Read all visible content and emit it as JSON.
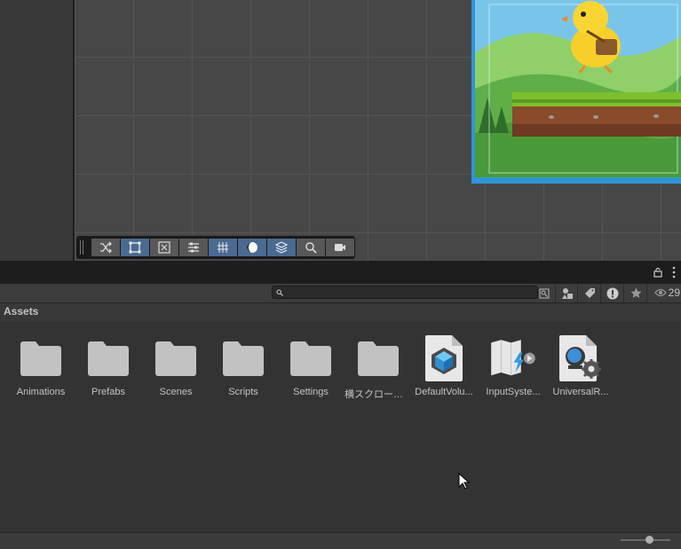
{
  "scene": {
    "toolbar": [
      {
        "name": "shuffle",
        "active": false
      },
      {
        "name": "rect",
        "active": true
      },
      {
        "name": "transform",
        "active": false
      },
      {
        "name": "align",
        "active": false
      },
      {
        "name": "grid",
        "active": true
      },
      {
        "name": "shading",
        "active": true
      },
      {
        "name": "layers",
        "active": true
      },
      {
        "name": "search",
        "active": false
      },
      {
        "name": "camera",
        "active": false
      }
    ]
  },
  "project": {
    "search": {
      "value": "",
      "placeholder": ""
    },
    "hidden_count": "29",
    "breadcrumb": "Assets",
    "assets": [
      {
        "label": "Animations",
        "icon": "folder-icon"
      },
      {
        "label": "Prefabs",
        "icon": "folder-icon"
      },
      {
        "label": "Scenes",
        "icon": "folder-icon"
      },
      {
        "label": "Scripts",
        "icon": "folder-icon"
      },
      {
        "label": "Settings",
        "icon": "folder-icon"
      },
      {
        "label": "横スクロールア...",
        "icon": "folder-icon"
      },
      {
        "label": "DefaultVolu...",
        "icon": "volume-profile-icon"
      },
      {
        "label": "InputSyste...",
        "icon": "input-actions-icon"
      },
      {
        "label": "UniversalR...",
        "icon": "render-pipeline-asset-icon"
      }
    ]
  },
  "colors": {
    "accent": "#4a6a91",
    "panel": "#333333",
    "folder": "#c2c2c2"
  }
}
